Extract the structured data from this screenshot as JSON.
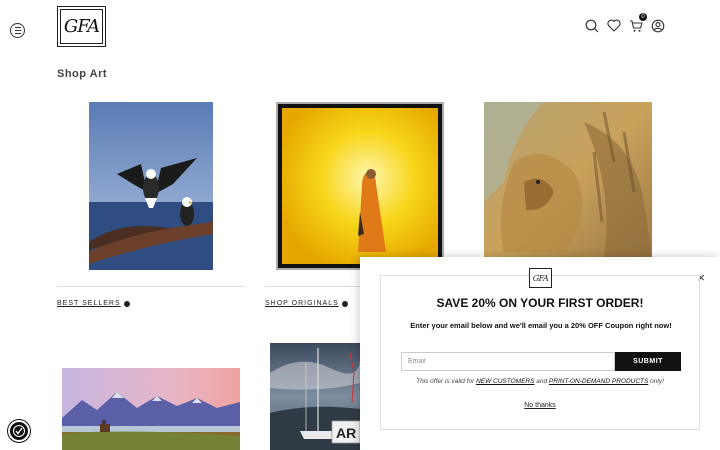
{
  "header": {
    "logo_text": "GFA",
    "cart_count": "0",
    "icons": [
      "menu-icon",
      "search-icon",
      "heart-icon",
      "cart-icon",
      "user-icon"
    ]
  },
  "page": {
    "title": "Shop Art"
  },
  "artworks": [
    {
      "name": "eagles-painting",
      "alt": "Two eagles on a branch over water"
    },
    {
      "name": "monk-painting",
      "alt": "Monk in orange robe against yellow light"
    },
    {
      "name": "lion-painting",
      "alt": "Lion face in golden brush strokes"
    },
    {
      "name": "mountain-landscape-painting",
      "alt": "Rider below purple mountains"
    },
    {
      "name": "sailboat-painting",
      "alt": "Sailboat under stormy sky"
    }
  ],
  "links": {
    "best_sellers": "BEST SELLERS",
    "shop_originals": "SHOP ORIGINALS"
  },
  "badge_text": "AR",
  "popup": {
    "logo_text": "GFA",
    "close_label": "×",
    "title": "SAVE 20% ON YOUR FIRST ORDER!",
    "description": "Enter your email below and we'll email you a 20% OFF Coupon right now!",
    "email_placeholder": "Email",
    "submit_label": "SUBMIT",
    "note_prefix": "This offer is valid for ",
    "note_link1": "NEW CUSTOMERS",
    "note_mid": " and ",
    "note_link2": "PRINT-ON-DEMAND PRODUCTS",
    "note_suffix": " only!",
    "no_thanks": "No thanks"
  },
  "colors": {
    "accent": "#111111",
    "background": "#ffffff"
  }
}
